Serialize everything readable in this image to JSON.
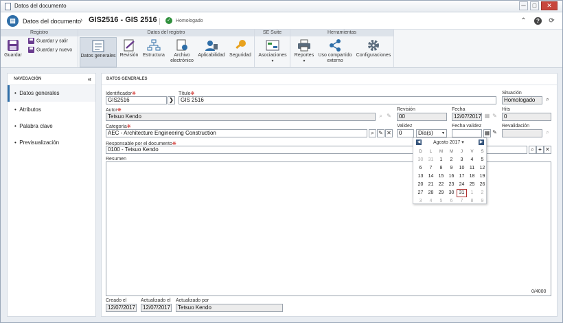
{
  "window": {
    "title": "Datos del documento",
    "minimize": "─",
    "maximize": "□",
    "close": "✕"
  },
  "header": {
    "app_title": "Datos del documento",
    "separator": "›",
    "doc_title": "GIS2516 - GIS 2516",
    "status_label": "Homologado",
    "icons": [
      "collapse-up-icon",
      "help-icon",
      "refresh-icon"
    ]
  },
  "ribbon": {
    "groups": [
      {
        "label": "Registro"
      },
      {
        "label": "Datos del registro"
      },
      {
        "label": "SE Suite"
      },
      {
        "label": "Herramientas"
      }
    ],
    "guardar": "Guardar",
    "guardar_y_salir": "Guardar y salir",
    "guardar_y_nuevo": "Guardar y nuevo",
    "datos_generales": "Datos generales",
    "revision": "Revisión",
    "estructura": "Estructura",
    "archivo_1": "Archivo",
    "archivo_2": "electrónico",
    "aplicabilidad": "Aplicabilidad",
    "seguridad": "Seguridad",
    "asociaciones": "Asociaciones",
    "reportes": "Reportes",
    "uso_1": "Uso compartido",
    "uso_2": "externo",
    "configuraciones": "Configuraciones",
    "dropdown_arrow": "▼"
  },
  "nav": {
    "title": "NAVEGACIÓN",
    "collapse": "«",
    "bullet": "•",
    "items": [
      {
        "label": "Datos generales"
      },
      {
        "label": "Atributos"
      },
      {
        "label": "Palabra clave"
      },
      {
        "label": "Previsualización"
      }
    ]
  },
  "main": {
    "title": "DATOS GENERALES",
    "req_mark": "❋",
    "identificador": {
      "label": "Identificador",
      "value": "GIS2516",
      "btn": "❯"
    },
    "titulo": {
      "label": "Título",
      "value": "GIS 2516"
    },
    "situacion": {
      "label": "Situación",
      "value": "Homologado"
    },
    "autor": {
      "label": "Autor",
      "value": "Tetsuo Kendo"
    },
    "revision": {
      "label": "Revisión",
      "value": "00"
    },
    "fecha": {
      "label": "Fecha",
      "value": "12/07/2017"
    },
    "hits": {
      "label": "Hits",
      "value": "0"
    },
    "categoria": {
      "label": "Categoría",
      "value": "AEC - Architecture Engineering Construction"
    },
    "validez": {
      "label": "Validez",
      "value": "0",
      "unit": "Día(s)"
    },
    "fecha_validez": {
      "label": "Fecha validez",
      "value": ""
    },
    "revalidacion": {
      "label": "Revalidación",
      "value": ""
    },
    "responsable": {
      "label": "Responsable por el documento",
      "value": "0100 - Tetsuo Kendo"
    },
    "resumen": {
      "label": "Resumen",
      "value": "",
      "counter": "0/4000"
    },
    "creado": {
      "label": "Creado el",
      "value": "12/07/2017"
    },
    "actualizado": {
      "label": "Actualizado el",
      "value": "12/07/2017"
    },
    "actualizado_por": {
      "label": "Actualizado por",
      "value": "Tetsuo Kendo"
    }
  },
  "calendar": {
    "month": "Agosto 2017",
    "month_arrow": "▾",
    "prev": "◀",
    "next": "▶",
    "weekdays": [
      "D",
      "L",
      "M",
      "M",
      "J",
      "V",
      "S"
    ],
    "weeks": [
      [
        "30",
        "31",
        "1",
        "2",
        "3",
        "4",
        "5"
      ],
      [
        "6",
        "7",
        "8",
        "9",
        "10",
        "11",
        "12"
      ],
      [
        "13",
        "14",
        "15",
        "16",
        "17",
        "18",
        "19"
      ],
      [
        "20",
        "21",
        "22",
        "23",
        "24",
        "25",
        "26"
      ],
      [
        "27",
        "28",
        "29",
        "30",
        "31",
        "1",
        "2"
      ],
      [
        "3",
        "4",
        "5",
        "6",
        "7",
        "8",
        "9"
      ]
    ],
    "selected": "31"
  },
  "colors": {
    "accent": "#2e6ea8",
    "required": "#d0322e",
    "status_ok": "#2f8f3c"
  }
}
